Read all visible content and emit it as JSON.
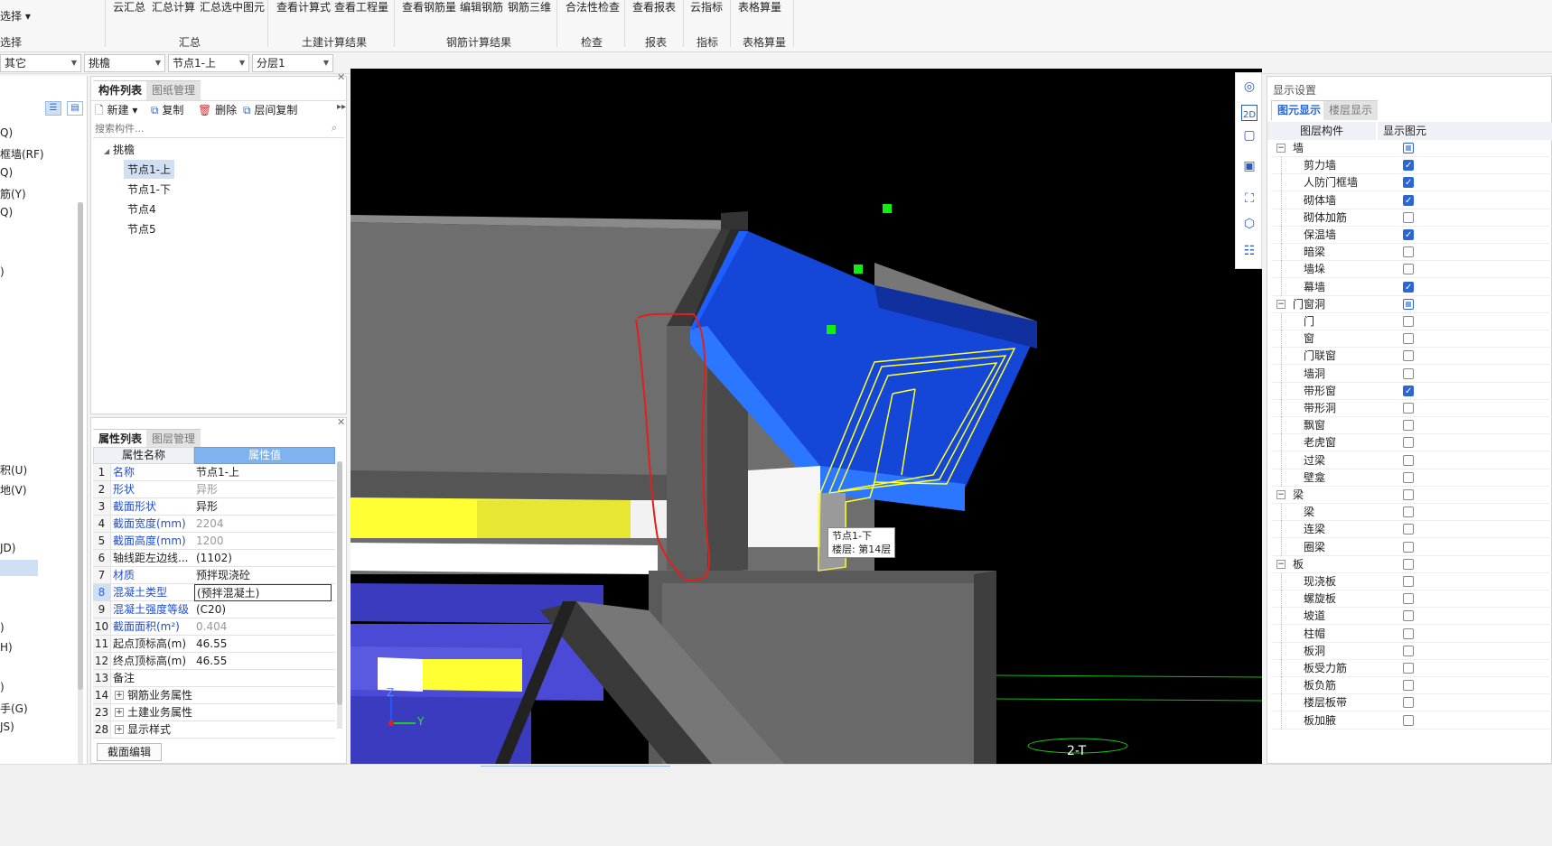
{
  "ribbon": {
    "items_top": [
      {
        "label": "云汇总"
      },
      {
        "label": "汇总计算"
      },
      {
        "label": "汇总选中图元"
      },
      {
        "label": "查看计算式"
      },
      {
        "label": "查看工程量"
      },
      {
        "label": "查看钢筋量"
      },
      {
        "label": "编辑钢筋"
      },
      {
        "label": "钢筋三维"
      },
      {
        "label": "合法性检查"
      },
      {
        "label": "查看报表"
      },
      {
        "label": "云指标"
      },
      {
        "label": "表格算量"
      }
    ],
    "left_partial_top": "选择 ▾",
    "groups": [
      {
        "label": "选择"
      },
      {
        "label": "汇总"
      },
      {
        "label": "土建计算结果"
      },
      {
        "label": "钢筋计算结果"
      },
      {
        "label": "检查"
      },
      {
        "label": "报表"
      },
      {
        "label": "指标"
      },
      {
        "label": "表格算量"
      }
    ]
  },
  "dropbar": {
    "filters": [
      {
        "value": "其它"
      },
      {
        "value": "挑檐"
      },
      {
        "value": "节点1-上"
      },
      {
        "value": "分层1"
      }
    ]
  },
  "left_strip": {
    "items": [
      "Q)",
      "框墙(RF)",
      "Q)",
      "筋(Y)",
      "Q)",
      ")",
      "积(U)",
      "地(V)",
      "JD)",
      ")",
      "H)",
      ")",
      "手(G)",
      "JS)"
    ]
  },
  "component_panel": {
    "tabs": [
      "构件列表",
      "图纸管理"
    ],
    "toolbar": {
      "new": "新建",
      "copy": "复制",
      "delete": "删除",
      "floor_copy": "层间复制"
    },
    "search_placeholder": "搜索构件...",
    "tree_root": "挑檐",
    "tree_items": [
      "节点1-上",
      "节点1-下",
      "节点4",
      "节点5"
    ]
  },
  "property_panel": {
    "tabs": [
      "属性列表",
      "图层管理"
    ],
    "header_name": "属性名称",
    "header_value": "属性值",
    "rows": [
      {
        "num": "1",
        "name": "名称",
        "value": "节点1-上"
      },
      {
        "num": "2",
        "name": "形状",
        "value": "异形"
      },
      {
        "num": "3",
        "name": "截面形状",
        "value": "异形"
      },
      {
        "num": "4",
        "name": "截面宽度(mm)",
        "value": "2204"
      },
      {
        "num": "5",
        "name": "截面高度(mm)",
        "value": "1200"
      },
      {
        "num": "6",
        "name": "轴线距左边线...",
        "value": "(1102)"
      },
      {
        "num": "7",
        "name": "材质",
        "value": "预拌现浇砼"
      },
      {
        "num": "8",
        "name": "混凝土类型",
        "value": "(预拌混凝土)"
      },
      {
        "num": "9",
        "name": "混凝土强度等级",
        "value": "(C20)"
      },
      {
        "num": "10",
        "name": "截面面积(m²)",
        "value": "0.404"
      },
      {
        "num": "11",
        "name": "起点顶标高(m)",
        "value": "46.55"
      },
      {
        "num": "12",
        "name": "终点顶标高(m)",
        "value": "46.55"
      },
      {
        "num": "13",
        "name": "备注",
        "value": ""
      },
      {
        "num": "14",
        "name": "钢筋业务属性",
        "value": ""
      },
      {
        "num": "23",
        "name": "土建业务属性",
        "value": ""
      },
      {
        "num": "28",
        "name": "显示样式",
        "value": ""
      }
    ],
    "edit_button": "截面编辑"
  },
  "viewport": {
    "tooltip_line1": "节点1-下",
    "tooltip_line2": "楼层: 第14层",
    "axis_z": "Z",
    "axis_y": "Y",
    "compass_label": "2-T"
  },
  "display_panel": {
    "title": "显示设置",
    "tabs": [
      "图元显示",
      "楼层显示"
    ],
    "col_component": "图层构件",
    "col_display": "显示图元",
    "rows": [
      {
        "label": "墙",
        "level": 0,
        "state": "part"
      },
      {
        "label": "剪力墙",
        "level": 1,
        "state": "on"
      },
      {
        "label": "人防门框墙",
        "level": 1,
        "state": "on"
      },
      {
        "label": "砌体墙",
        "level": 1,
        "state": "on"
      },
      {
        "label": "砌体加筋",
        "level": 1,
        "state": "off"
      },
      {
        "label": "保温墙",
        "level": 1,
        "state": "on"
      },
      {
        "label": "暗梁",
        "level": 1,
        "state": "off"
      },
      {
        "label": "墙垛",
        "level": 1,
        "state": "off"
      },
      {
        "label": "幕墙",
        "level": 1,
        "state": "on"
      },
      {
        "label": "门窗洞",
        "level": 0,
        "state": "part"
      },
      {
        "label": "门",
        "level": 1,
        "state": "off"
      },
      {
        "label": "窗",
        "level": 1,
        "state": "off"
      },
      {
        "label": "门联窗",
        "level": 1,
        "state": "off"
      },
      {
        "label": "墙洞",
        "level": 1,
        "state": "off"
      },
      {
        "label": "带形窗",
        "level": 1,
        "state": "on"
      },
      {
        "label": "带形洞",
        "level": 1,
        "state": "off"
      },
      {
        "label": "飘窗",
        "level": 1,
        "state": "off"
      },
      {
        "label": "老虎窗",
        "level": 1,
        "state": "off"
      },
      {
        "label": "过梁",
        "level": 1,
        "state": "off"
      },
      {
        "label": "壁龛",
        "level": 1,
        "state": "off"
      },
      {
        "label": "梁",
        "level": 0,
        "state": "off"
      },
      {
        "label": "梁",
        "level": 1,
        "state": "off"
      },
      {
        "label": "连梁",
        "level": 1,
        "state": "off"
      },
      {
        "label": "圈梁",
        "level": 1,
        "state": "off"
      },
      {
        "label": "板",
        "level": 0,
        "state": "off"
      },
      {
        "label": "现浇板",
        "level": 1,
        "state": "off"
      },
      {
        "label": "螺旋板",
        "level": 1,
        "state": "off"
      },
      {
        "label": "坡道",
        "level": 1,
        "state": "off"
      },
      {
        "label": "柱帽",
        "level": 1,
        "state": "off"
      },
      {
        "label": "板洞",
        "level": 1,
        "state": "off"
      },
      {
        "label": "板受力筋",
        "level": 1,
        "state": "off"
      },
      {
        "label": "板负筋",
        "level": 1,
        "state": "off"
      },
      {
        "label": "楼层板带",
        "level": 1,
        "state": "off"
      },
      {
        "label": "板加腋",
        "level": 1,
        "state": "off"
      }
    ]
  },
  "colors": {
    "accent": "#2c66d6",
    "selection": "#cfe0f5",
    "viewport_bg": "#000000",
    "model_blue": "#1e5fff",
    "model_yellow": "#ffff33",
    "markup_red": "#e0201b"
  }
}
